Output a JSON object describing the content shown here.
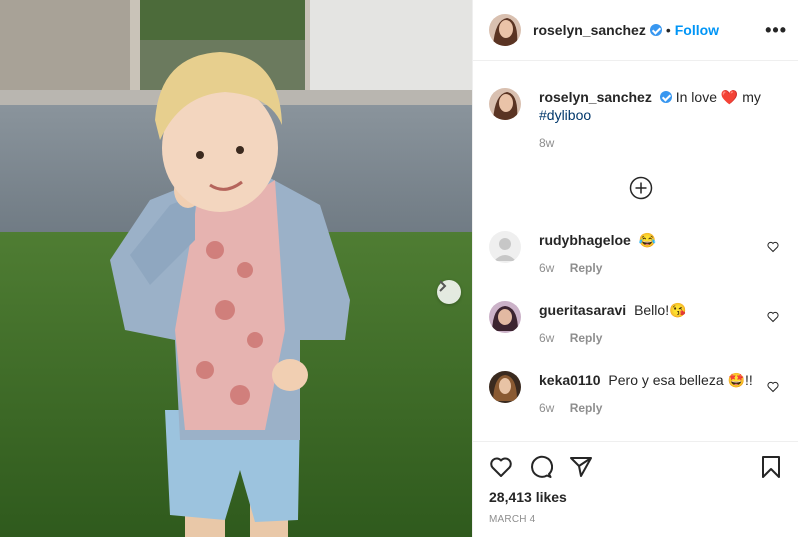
{
  "post": {
    "author": "roselyn_sanchez",
    "follow_label": "Follow",
    "header_separator": "•",
    "more_label": "•••",
    "caption": {
      "username": "roselyn_sanchez",
      "text_before": "In love",
      "emoji": "❤️",
      "text_after": "my",
      "hashtag": "#dyliboo",
      "age": "8w"
    },
    "comments": [
      {
        "username": "rudybhageloe",
        "text": "",
        "emoji": "😂",
        "suffix": "",
        "age": "6w",
        "reply": "Reply"
      },
      {
        "username": "gueritasaravi",
        "text": "Bello!",
        "emoji": "😘",
        "suffix": "",
        "age": "6w",
        "reply": "Reply"
      },
      {
        "username": "keka0110",
        "text": "Pero y esa belleza",
        "emoji": "🤩",
        "suffix": "!!",
        "age": "6w",
        "reply": "Reply"
      }
    ],
    "likes": "28,413 likes",
    "date": "MARCH 4"
  },
  "icons": {
    "verified": "verified-badge-icon",
    "more": "more-options-icon",
    "load_more": "plus-circle-icon",
    "like": "heart-icon",
    "comment": "comment-icon",
    "share": "share-icon",
    "save": "bookmark-icon",
    "next": "chevron-right-icon"
  },
  "colors": {
    "accent": "#0095f6",
    "verified": "#3897f0",
    "secondary_text": "#8e8e8e",
    "hashtag": "#00376b"
  }
}
